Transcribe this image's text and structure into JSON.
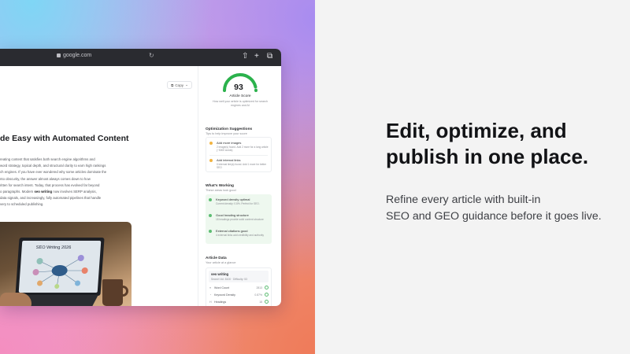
{
  "browser": {
    "url": "google.com",
    "copy_label": "Copy"
  },
  "article": {
    "title": "de Easy with Automated Content",
    "paragraph_lines": [
      "reating content that satisfies both search engine algorithms and",
      "word strategy, topical depth, and structural clarity to earn high rankings",
      "ch engines. If you have ever wondered why some articles dominate the",
      "nto obscurity, the answer almost always comes down to how",
      "ritten for search intent. Today, that process has evolved far beyond",
      "o paragraphs. Modern "
    ],
    "bold_phrase": "seo writing",
    "line6_rest": " now involves SERP analysis,",
    "paragraph_tail": [
      "data signals, and increasingly, fully automated pipelines that handle",
      "very to scheduled publishing."
    ],
    "image_caption": "SEO Writing 2026"
  },
  "score": {
    "value": 93,
    "percent": 93,
    "label": "Article Score",
    "description_lines": [
      "How well your article is optimized for search",
      "engines and AI"
    ]
  },
  "suggestions": {
    "heading": "Optimization Suggestions",
    "subheading": "Tips to help improve your score",
    "items": [
      {
        "title": "Add more images",
        "desc": "2 image(s) found. Add 2 more for a long article (~5000 words)",
        "color": "#f2b441"
      },
      {
        "title": "Add internal links",
        "desc": "0 internal link(s) found. Add 1 more for better SEO",
        "color": "#f2b441"
      }
    ]
  },
  "working": {
    "heading": "What's Working",
    "subheading": "These areas look good",
    "items": [
      {
        "title": "Keyword density optimal",
        "desc": "Current density: 0.8%. Perfect for SEO.",
        "color": "#5dbd73"
      },
      {
        "title": "Good heading structure",
        "desc": "18 headings provide solid content structure",
        "color": "#5dbd73"
      },
      {
        "title": "External citations good",
        "desc": "4 external links add credibility and authority",
        "color": "#5dbd73"
      }
    ]
  },
  "article_data": {
    "heading": "Article Data",
    "subheading": "Your article at a glance",
    "keyword": "seo writing",
    "keyword_meta": "Search Vol: 8100 · Difficulty: 53",
    "rows": [
      {
        "icon": "≡",
        "label": "Word Count",
        "value": "2813"
      },
      {
        "icon": "◔",
        "label": "Keyword Density",
        "value": "0.87%"
      },
      {
        "icon": "H",
        "label": "Headings",
        "value": "18"
      }
    ]
  },
  "marketing": {
    "headline_lines": [
      "Edit, optimize, and",
      "publish in one place."
    ],
    "sub_lines": [
      "Refine every article with built-in",
      "SEO and GEO guidance before it goes live."
    ]
  },
  "colors": {
    "gauge": "#2bb24c",
    "warning": "#f2b441",
    "success": "#5dbd73"
  }
}
